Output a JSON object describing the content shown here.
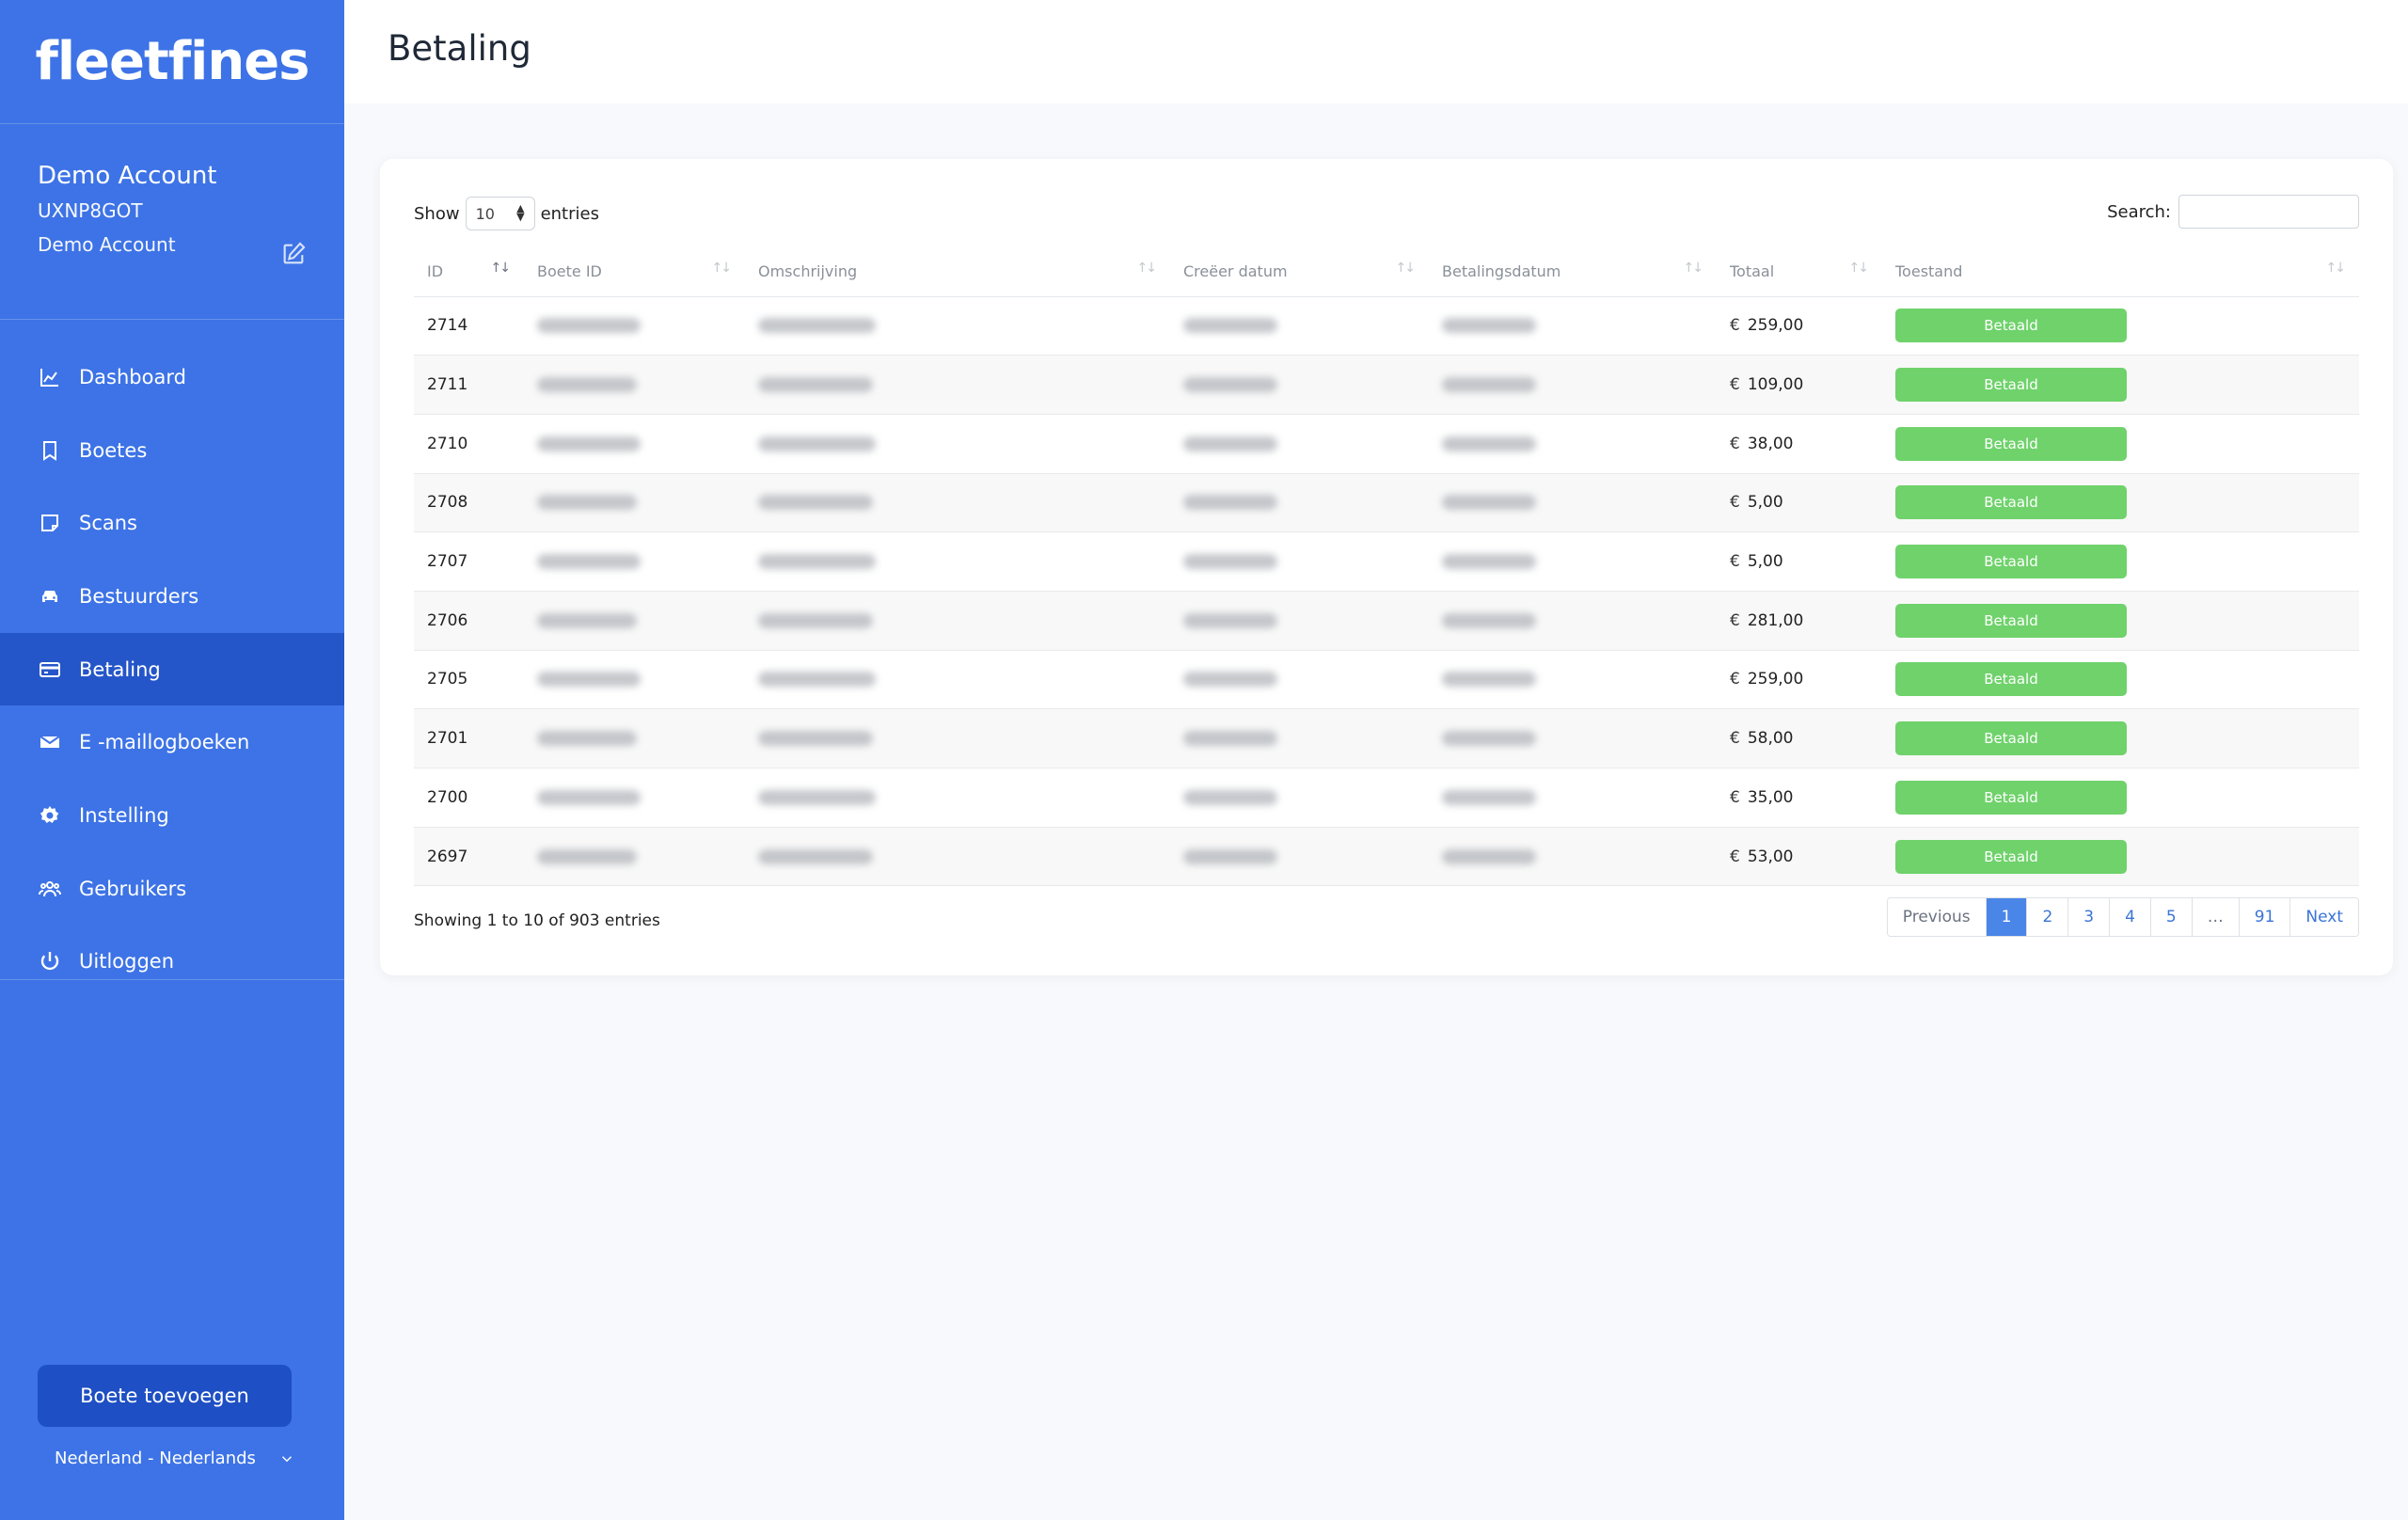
{
  "app": {
    "logo": "fleetfines"
  },
  "account": {
    "name": "Demo Account",
    "code": "UXNP8GOT",
    "subtitle": "Demo Account"
  },
  "nav": [
    {
      "label": "Dashboard",
      "icon": "chart-icon"
    },
    {
      "label": "Boetes",
      "icon": "bookmark-icon"
    },
    {
      "label": "Scans",
      "icon": "note-icon"
    },
    {
      "label": "Bestuurders",
      "icon": "car-icon"
    },
    {
      "label": "Betaling",
      "icon": "credit-card-icon",
      "active": true
    },
    {
      "label": "E -maillogboeken",
      "icon": "envelope-icon"
    },
    {
      "label": "Instelling",
      "icon": "gear-icon"
    },
    {
      "label": "Gebruikers",
      "icon": "users-icon"
    },
    {
      "label": "Uitloggen",
      "icon": "power-icon"
    }
  ],
  "sidebar_footer": {
    "add_button": "Boete toevoegen",
    "language": "Nederland - Nederlands"
  },
  "page": {
    "title": "Betaling"
  },
  "table_controls": {
    "show_label": "Show",
    "page_size": "10",
    "entries_label": "entries",
    "search_label": "Search:",
    "search_value": ""
  },
  "columns": [
    "ID",
    "Boete ID",
    "Omschrijving",
    "Creëer datum",
    "Betalingsdatum",
    "Totaal",
    "Toestand"
  ],
  "currency": "€",
  "rows": [
    {
      "id": "2714",
      "total": "259,00",
      "status": "Betaald"
    },
    {
      "id": "2711",
      "total": "109,00",
      "status": "Betaald"
    },
    {
      "id": "2710",
      "total": "38,00",
      "status": "Betaald"
    },
    {
      "id": "2708",
      "total": "5,00",
      "status": "Betaald"
    },
    {
      "id": "2707",
      "total": "5,00",
      "status": "Betaald"
    },
    {
      "id": "2706",
      "total": "281,00",
      "status": "Betaald"
    },
    {
      "id": "2705",
      "total": "259,00",
      "status": "Betaald"
    },
    {
      "id": "2701",
      "total": "58,00",
      "status": "Betaald"
    },
    {
      "id": "2700",
      "total": "35,00",
      "status": "Betaald"
    },
    {
      "id": "2697",
      "total": "53,00",
      "status": "Betaald"
    }
  ],
  "footer": {
    "info": "Showing 1 to 10 of 903 entries"
  },
  "pagination": {
    "previous": "Previous",
    "pages": [
      "1",
      "2",
      "3",
      "4",
      "5",
      "…",
      "91"
    ],
    "next": "Next",
    "current": "1"
  },
  "colors": {
    "sidebar": "#3d73e6",
    "active_nav": "#2556c9",
    "badge": "#6fd26b",
    "accent": "#4a86e8"
  }
}
